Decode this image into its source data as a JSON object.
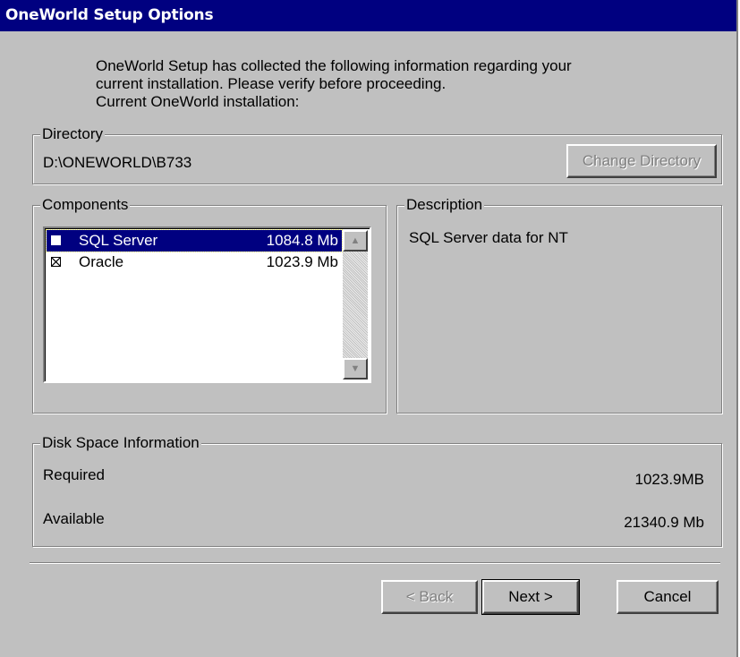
{
  "window": {
    "title": "OneWorld Setup Options"
  },
  "intro": {
    "line1": "OneWorld Setup has collected the following information regarding your",
    "line2": "current installation.  Please verify before proceeding.",
    "line3": "Current OneWorld installation:"
  },
  "directory": {
    "legend": "Directory",
    "path": "D:\\ONEWORLD\\B733",
    "change_button": {
      "label": "Change Directory",
      "enabled": false
    }
  },
  "components": {
    "legend": "Components",
    "items": [
      {
        "name": "SQL Server",
        "size": "1084.8 Mb",
        "checked": false,
        "selected": true
      },
      {
        "name": "Oracle",
        "size": "1023.9 Mb",
        "checked": true,
        "selected": false
      }
    ]
  },
  "description": {
    "legend": "Description",
    "text": "SQL Server data for NT"
  },
  "disk_space": {
    "legend": "Disk Space Information",
    "required_label": "Required",
    "required_value": "1023.9MB",
    "available_label": "Available",
    "available_value": "21340.9 Mb"
  },
  "buttons": {
    "back": {
      "label": "< Back",
      "enabled": false
    },
    "next": {
      "label": "Next >",
      "enabled": true
    },
    "cancel": {
      "label": "Cancel",
      "enabled": true
    }
  }
}
